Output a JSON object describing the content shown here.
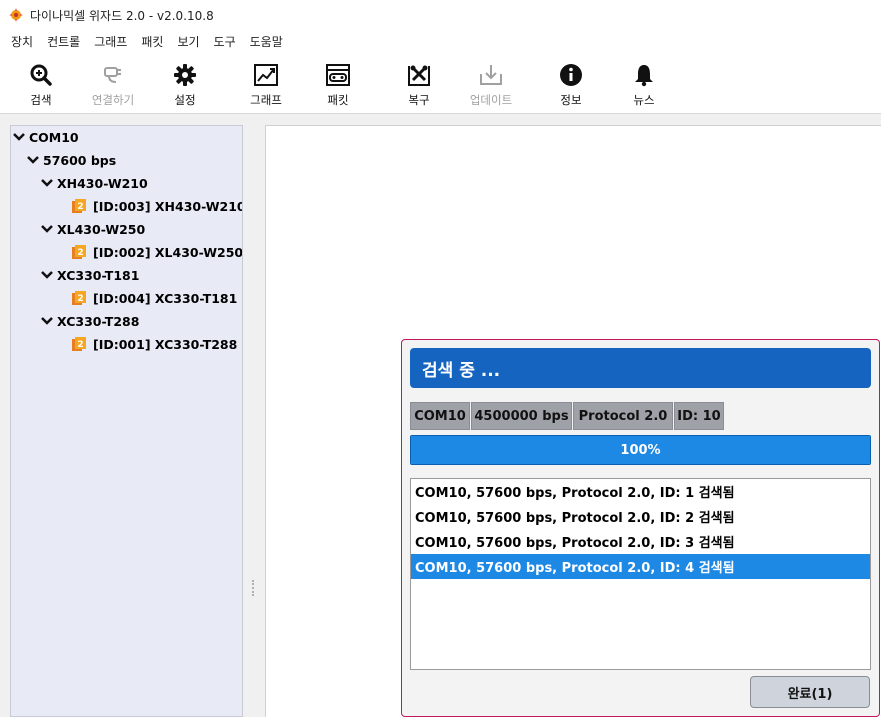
{
  "window": {
    "title": "다이나믹셀 위자드 2.0 - v2.0.10.8"
  },
  "menu": [
    "장치",
    "컨트롤",
    "그래프",
    "패킷",
    "보기",
    "도구",
    "도움말"
  ],
  "toolbar": {
    "scan": "검색",
    "connect": "연결하기",
    "settings": "설정",
    "graph": "그래프",
    "packet": "패킷",
    "recovery": "복구",
    "update": "업데이트",
    "info": "정보",
    "news": "뉴스"
  },
  "tree": {
    "port": "COM10",
    "baud": "57600 bps",
    "models": [
      {
        "name": "XH430-W210",
        "device": "[ID:003] XH430-W210"
      },
      {
        "name": "XL430-W250",
        "device": "[ID:002] XL430-W250"
      },
      {
        "name": "XC330-T181",
        "device": "[ID:004] XC330-T181"
      },
      {
        "name": "XC330-T288",
        "device": "[ID:001] XC330-T288"
      }
    ]
  },
  "dialog": {
    "title": "검색 중 ...",
    "status": {
      "port": "COM10",
      "baud": "4500000 bps",
      "protocol": "Protocol 2.0",
      "id": "ID: 10"
    },
    "progress": {
      "percent": 100,
      "label": "100%"
    },
    "log": [
      "COM10, 57600 bps, Protocol 2.0, ID: 1 검색됨",
      "COM10, 57600 bps, Protocol 2.0, ID: 2 검색됨",
      "COM10, 57600 bps, Protocol 2.0, ID: 3 검색됨",
      "COM10, 57600 bps, Protocol 2.0, ID: 4 검색됨"
    ],
    "selected_log_index": 3,
    "done_button": "완료(1)"
  },
  "colors": {
    "accent": "#1565c0",
    "progress": "#1e88e5",
    "dialog_border": "#c2185b",
    "tree_bg": "#e8eaf6",
    "device_icon": "#f39c12"
  }
}
